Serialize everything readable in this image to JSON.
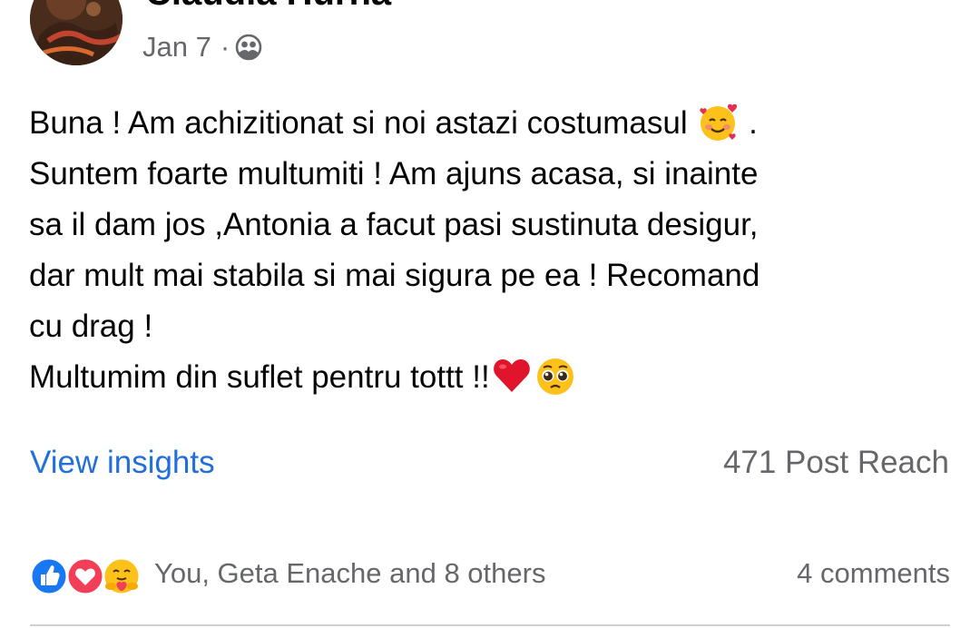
{
  "post": {
    "author": "Claudia Hurnă",
    "date": "Jan 7",
    "separator": "·",
    "audience_icon": "friends-icon",
    "text_lines": [
      "Buna ! Am achizitionat si noi astazi costumasul",
      ".",
      "Suntem foarte multumiti ! Am ajuns acasa, si inainte",
      "sa il dam jos ,Antonia a facut pasi sustinuta desigur,",
      "dar mult mai stabila si mai sigura pe ea ! Recomand",
      "cu drag !",
      "Multumim din suflet pentru tottt !!"
    ],
    "emojis": [
      "smiling-face-with-hearts",
      "red-heart",
      "pleading-face"
    ]
  },
  "insights": {
    "link_label": "View insights",
    "reach": "471 Post Reach"
  },
  "reactions": {
    "icons": [
      "like-icon",
      "love-icon",
      "care-icon"
    ],
    "names": "You, Geta Enache and 8 others",
    "comments": "4 comments"
  },
  "colors": {
    "link_blue": "#216fdb",
    "secondary_text": "#65676b",
    "like_blue": "#1877f2",
    "love_red": "#f33e58",
    "divider": "#ced0d4"
  }
}
